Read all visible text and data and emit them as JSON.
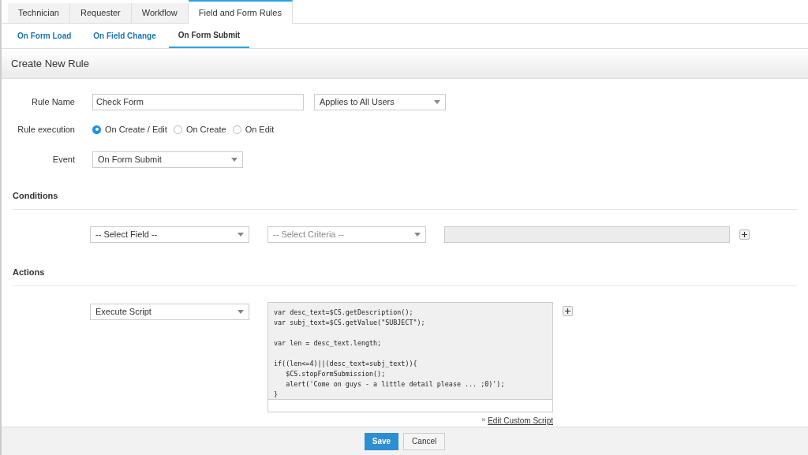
{
  "tabs": [
    {
      "label": "Technician",
      "selected": false
    },
    {
      "label": "Requester",
      "selected": false
    },
    {
      "label": "Workflow",
      "selected": false
    },
    {
      "label": "Field and Form Rules",
      "selected": true
    }
  ],
  "subtabs": [
    {
      "label": "On Form Load",
      "selected": false
    },
    {
      "label": "On Field Change",
      "selected": false
    },
    {
      "label": "On Form Submit",
      "selected": true
    }
  ],
  "panel_title": "Create New Rule",
  "rule_name": {
    "label": "Rule Name",
    "value": "Check Form",
    "scope": "Applies to All Users"
  },
  "rule_execution": {
    "label": "Rule execution",
    "options": [
      {
        "label": "On Create / Edit",
        "selected": true
      },
      {
        "label": "On Create",
        "selected": false
      },
      {
        "label": "On Edit",
        "selected": false
      }
    ]
  },
  "event": {
    "label": "Event",
    "value": "On Form Submit"
  },
  "conditions": {
    "title": "Conditions",
    "field": "-- Select Field --",
    "criteria": "-- Select Criteria --"
  },
  "actions": {
    "title": "Actions",
    "action": "Execute Script",
    "script": "var desc_text=$CS.getDescription();\nvar subj_text=$CS.getValue(\"SUBJECT\");\n\nvar len = desc_text.length;\n\nif((len<=4)||(desc_text=subj_text)){\n   $CS.stopFormSubmission();\n   alert('Come on guys - a little detail please ... ;0)');\n}",
    "link_prefix": "»",
    "link": "Edit Custom Script"
  },
  "buttons": [
    {
      "label": "Save",
      "kind": "primary"
    },
    {
      "label": "Cancel",
      "kind": "secondary"
    }
  ]
}
